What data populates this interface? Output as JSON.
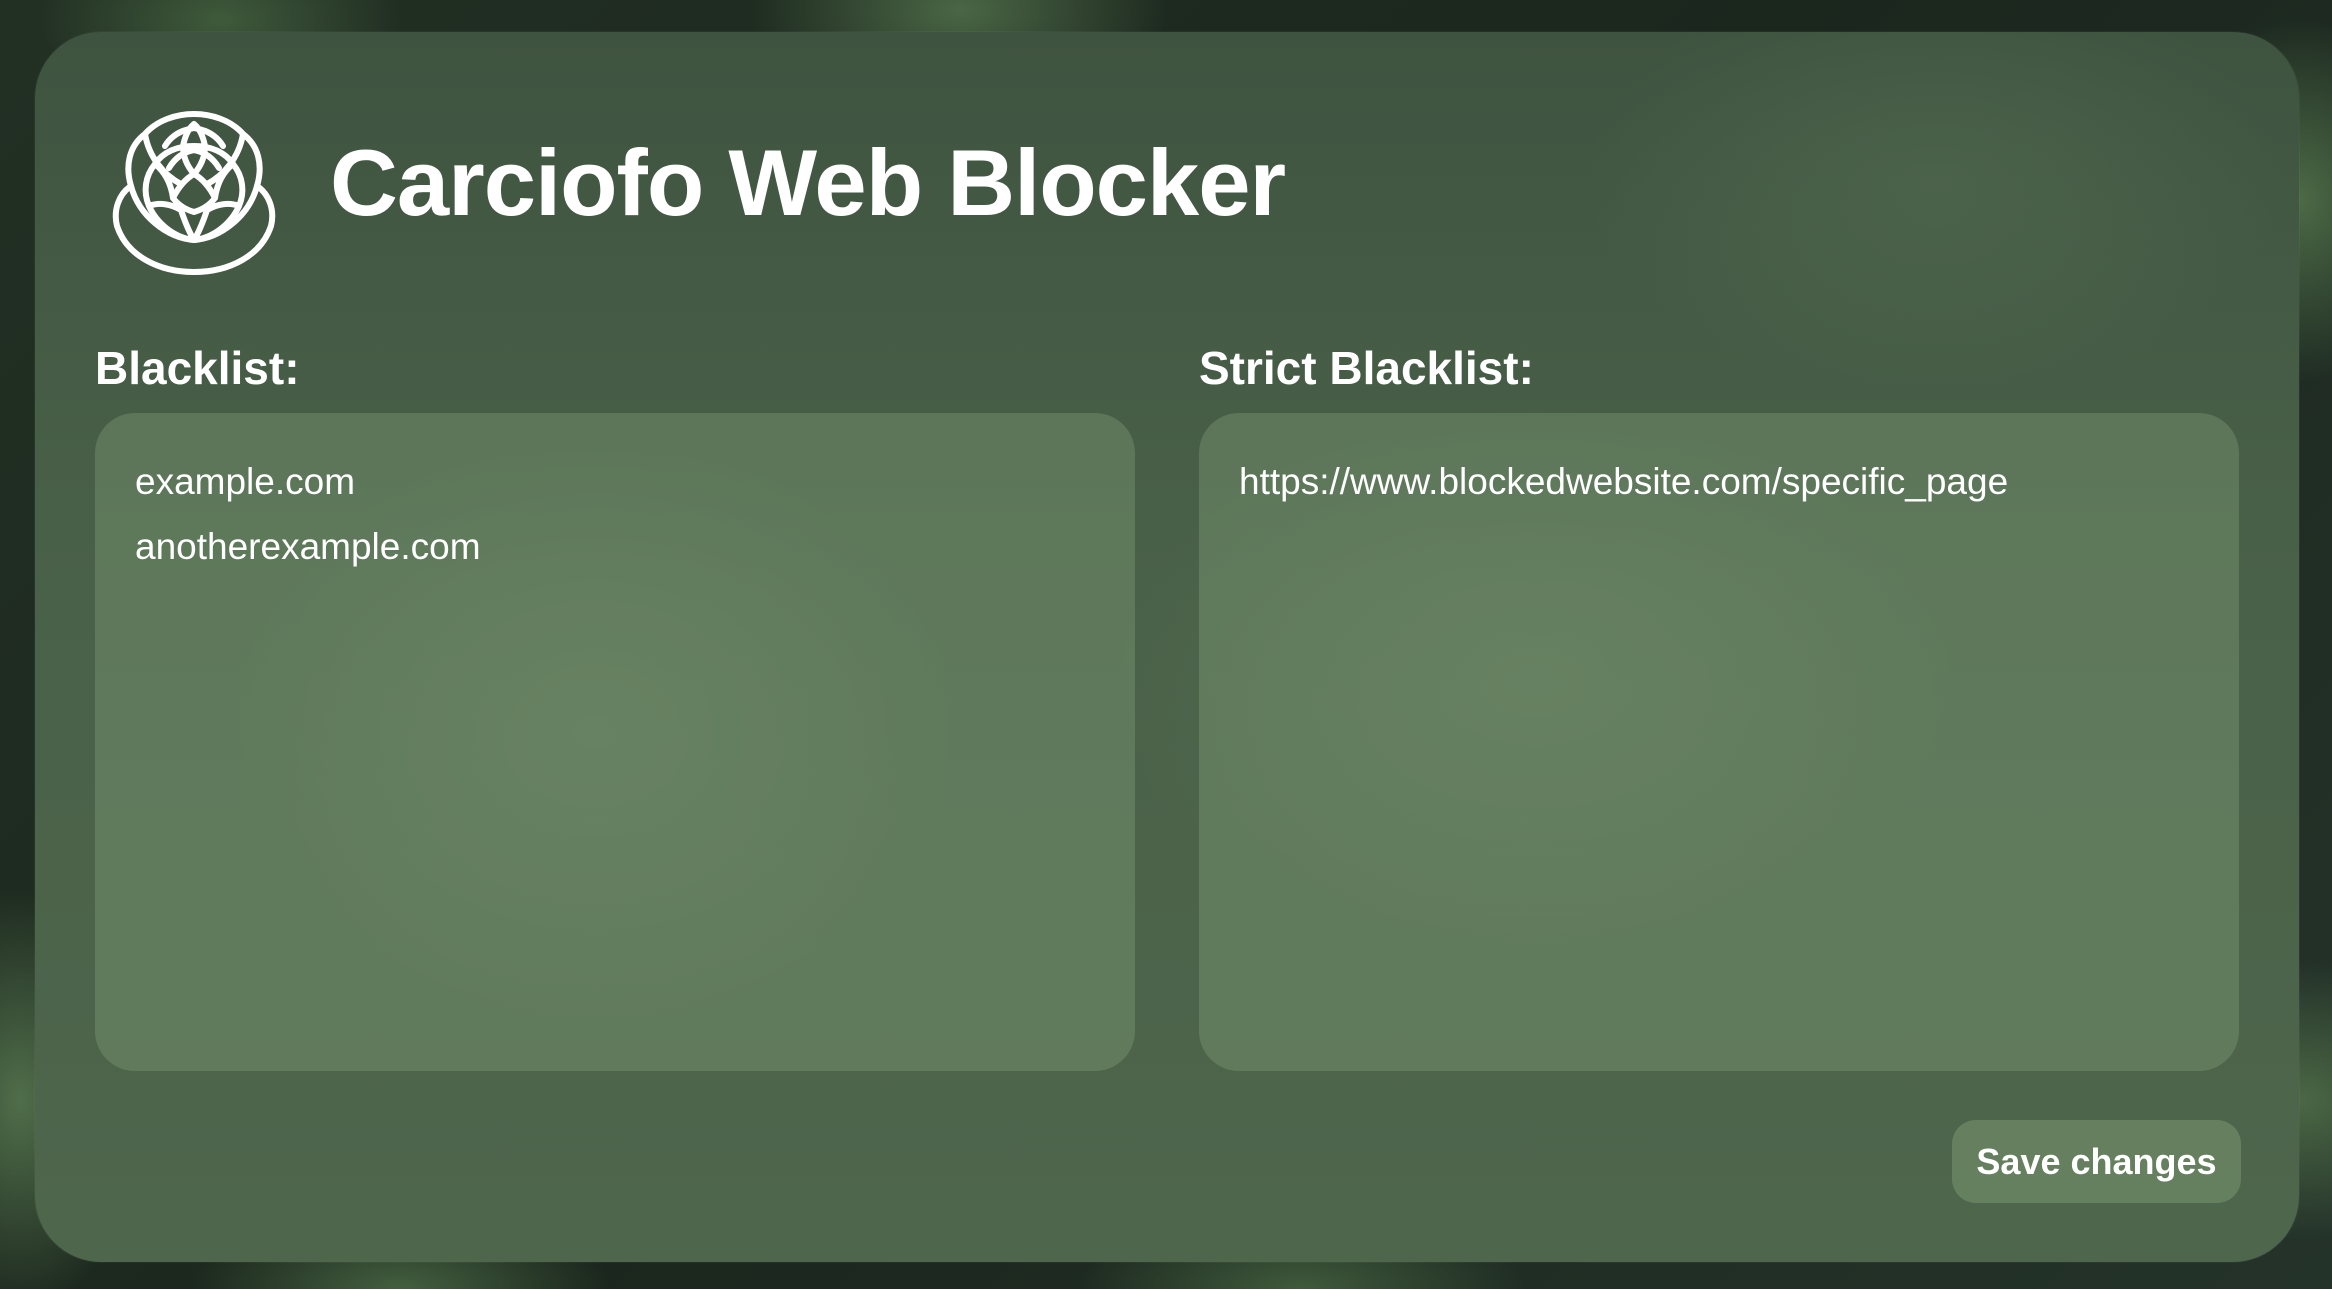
{
  "app": {
    "title": "Carciofo Web Blocker",
    "logo_icon": "artichoke-icon"
  },
  "blacklist": {
    "label": "Blacklist:",
    "entries": [
      "example.com",
      "anotherexample.com"
    ]
  },
  "strict_blacklist": {
    "label": "Strict Blacklist:",
    "entries": [
      "https://www.blockedwebsite.com/specific_page"
    ]
  },
  "actions": {
    "save_label": "Save changes"
  },
  "colors": {
    "text": "#ffffff",
    "panel": "#4a6149",
    "textarea": "#6f8a68"
  }
}
